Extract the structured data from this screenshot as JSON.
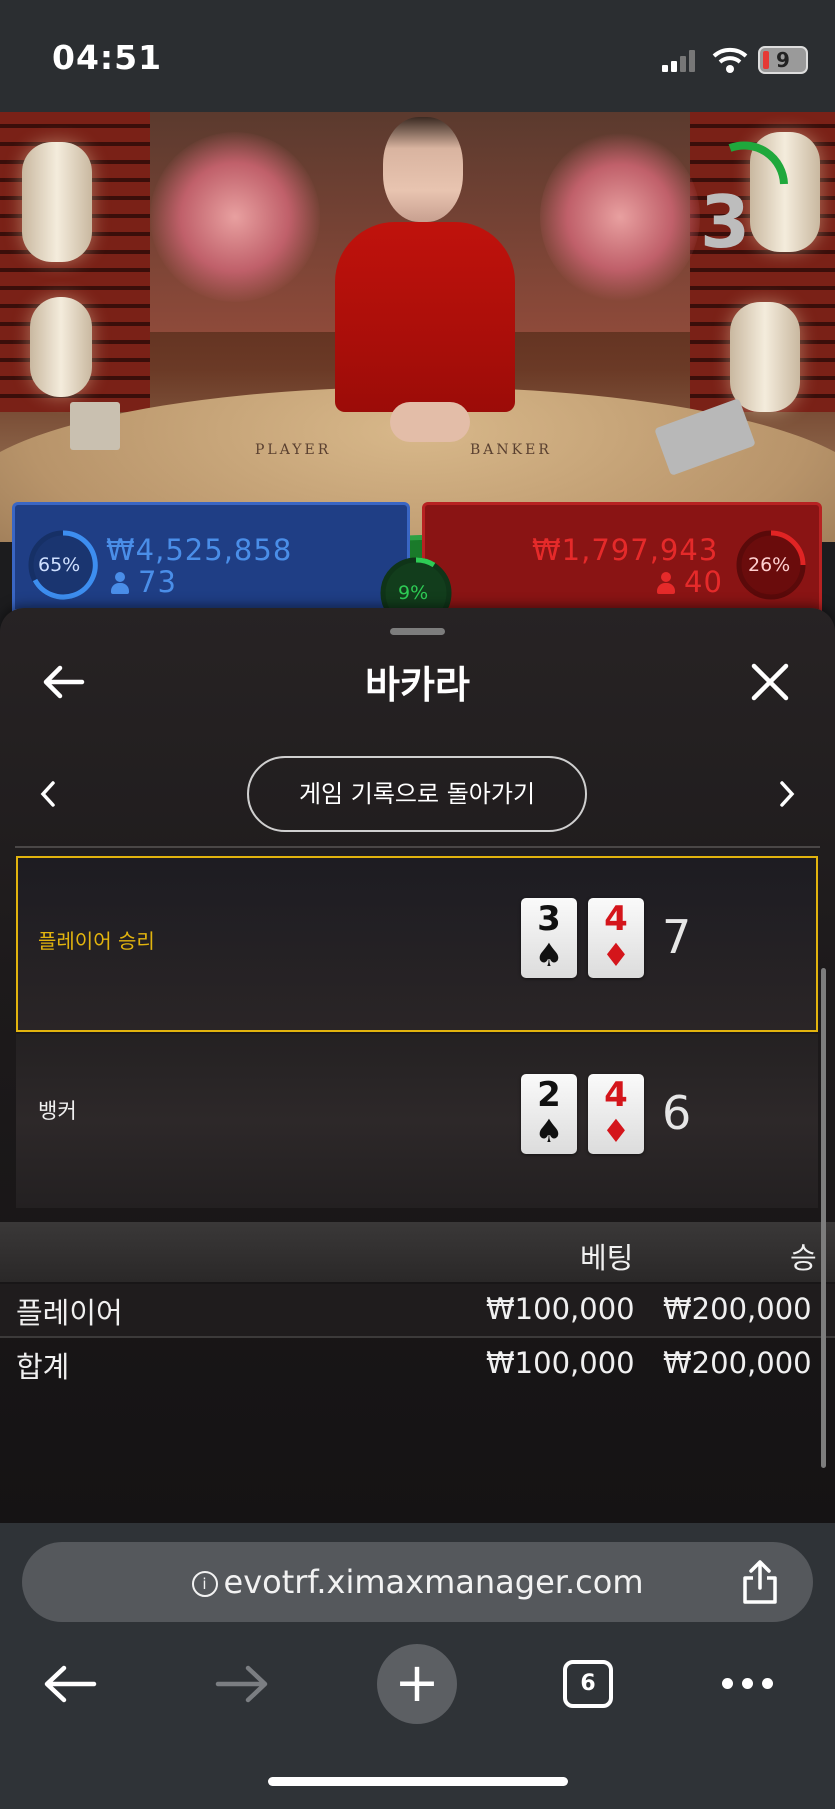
{
  "status_bar": {
    "time": "04:51",
    "battery": "9"
  },
  "stream": {
    "countdown": "3",
    "table_labels": {
      "player": "PLAYER",
      "banker": "BANKER"
    },
    "player_bets": {
      "percent": "65%",
      "amount": "₩4,525,858",
      "players": "73"
    },
    "banker_bets": {
      "percent": "26%",
      "amount": "₩1,797,943",
      "players": "40"
    },
    "tie_percent": "9%"
  },
  "sheet": {
    "title": "바카라",
    "back_to_history": "게임 기록으로 돌아가기",
    "player_hand": {
      "label": "플레이어 승리",
      "cards": [
        {
          "rank": "3",
          "suit": "♠"
        },
        {
          "rank": "4",
          "suit": "♦"
        }
      ],
      "total": "7"
    },
    "banker_hand": {
      "label": "뱅커",
      "cards": [
        {
          "rank": "2",
          "suit": "♠"
        },
        {
          "rank": "4",
          "suit": "♦"
        }
      ],
      "total": "6"
    },
    "bets_table": {
      "headers": {
        "bet": "베팅",
        "win": "승"
      },
      "rows": [
        {
          "name": "플레이어",
          "bet": "₩100,000",
          "win": "₩200,000"
        }
      ],
      "total": {
        "name": "합계",
        "bet": "₩100,000",
        "win": "₩200,000"
      }
    }
  },
  "browser": {
    "url": "evotrf.ximaxmanager.com",
    "tab_count": "6"
  },
  "colors": {
    "player_blue": "#1f3e85",
    "banker_red": "#8a1414",
    "winner_gold": "#e2b40e",
    "tie_green": "#2ea043"
  }
}
